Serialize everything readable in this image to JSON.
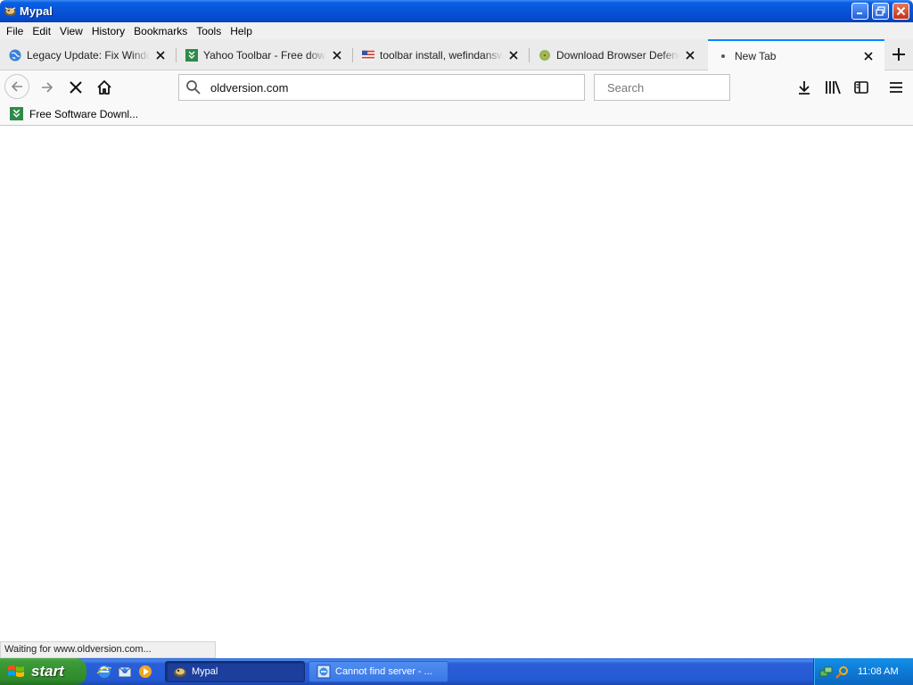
{
  "window": {
    "title": "Mypal"
  },
  "menubar": {
    "items": [
      "File",
      "Edit",
      "View",
      "History",
      "Bookmarks",
      "Tools",
      "Help"
    ]
  },
  "tabs": [
    {
      "label": "Legacy Update: Fix Windows",
      "icon": "globe-icon"
    },
    {
      "label": "Yahoo Toolbar - Free downlo",
      "icon": "download-favicon-icon"
    },
    {
      "label": "toolbar install, wefindanswer",
      "icon": "flag-favicon-icon"
    },
    {
      "label": "Download Browser Defender",
      "icon": "defender-favicon-icon"
    },
    {
      "label": "New Tab",
      "icon": "loading-dot-icon",
      "active": true
    }
  ],
  "navbar": {
    "url_value": "oldversion.com",
    "search_placeholder": "Search"
  },
  "bookmarks": [
    {
      "label": "Free Software Downl..."
    }
  ],
  "status": {
    "text": "Waiting for www.oldversion.com..."
  },
  "taskbar": {
    "start_label": "start",
    "items": [
      {
        "label": "Mypal",
        "active": true
      },
      {
        "label": "Cannot find server - ...",
        "active": false
      }
    ],
    "clock": "11:08 AM"
  },
  "colors": {
    "titlebar_blue": "#0753d8",
    "active_tab_accent": "#0a84ff",
    "start_green": "#3c9a37",
    "favicon_green": "#2e8b47"
  }
}
